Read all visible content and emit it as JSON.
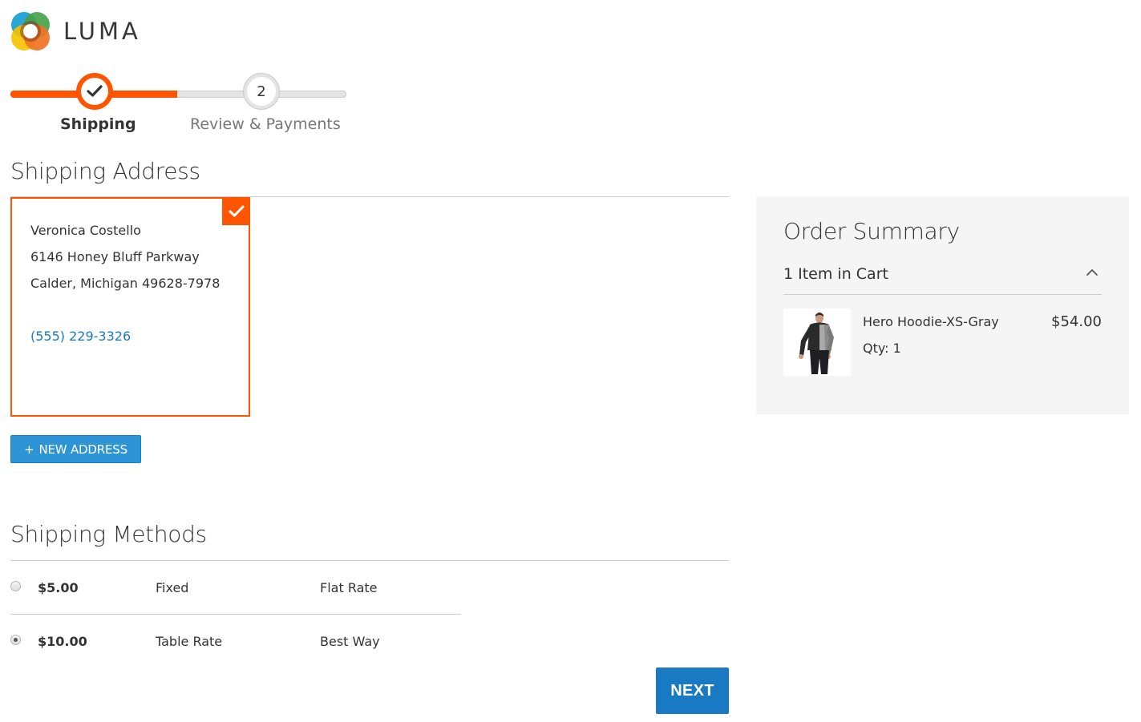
{
  "brand": {
    "name": "LUMA"
  },
  "progress": {
    "steps": [
      {
        "label": "Shipping",
        "status": "complete"
      },
      {
        "number": "2",
        "label": "Review & Payments",
        "status": "pending"
      }
    ]
  },
  "shipping_address": {
    "title": "Shipping Address",
    "selected": {
      "name": "Veronica Costello",
      "street": "6146 Honey Bluff Parkway",
      "city_line": "Calder, Michigan 49628-7978",
      "phone": "(555) 229-3326"
    },
    "new_address_label": "NEW ADDRESS",
    "new_address_icon": "+"
  },
  "shipping_methods": {
    "title": "Shipping Methods",
    "rows": [
      {
        "price": "$5.00",
        "method": "Fixed",
        "carrier": "Flat Rate",
        "selected": false
      },
      {
        "price": "$10.00",
        "method": "Table Rate",
        "carrier": "Best Way",
        "selected": true
      }
    ],
    "next_label": "NEXT"
  },
  "order_summary": {
    "title": "Order Summary",
    "cart_count_label": "1 Item in Cart",
    "items": [
      {
        "name": "Hero Hoodie-XS-Gray",
        "qty_label": "Qty: 1",
        "price": "$54.00"
      }
    ]
  },
  "colors": {
    "accent_orange": "#ff5501",
    "primary_blue": "#1979c3",
    "button_blue": "#2d95d6",
    "summary_bg": "#f5f5f5"
  },
  "icons": {
    "logo": "luma-logo-icon",
    "step_complete": "checkmark-icon",
    "selected_address": "checkmark-icon",
    "cart_toggle": "chevron-up-icon"
  }
}
